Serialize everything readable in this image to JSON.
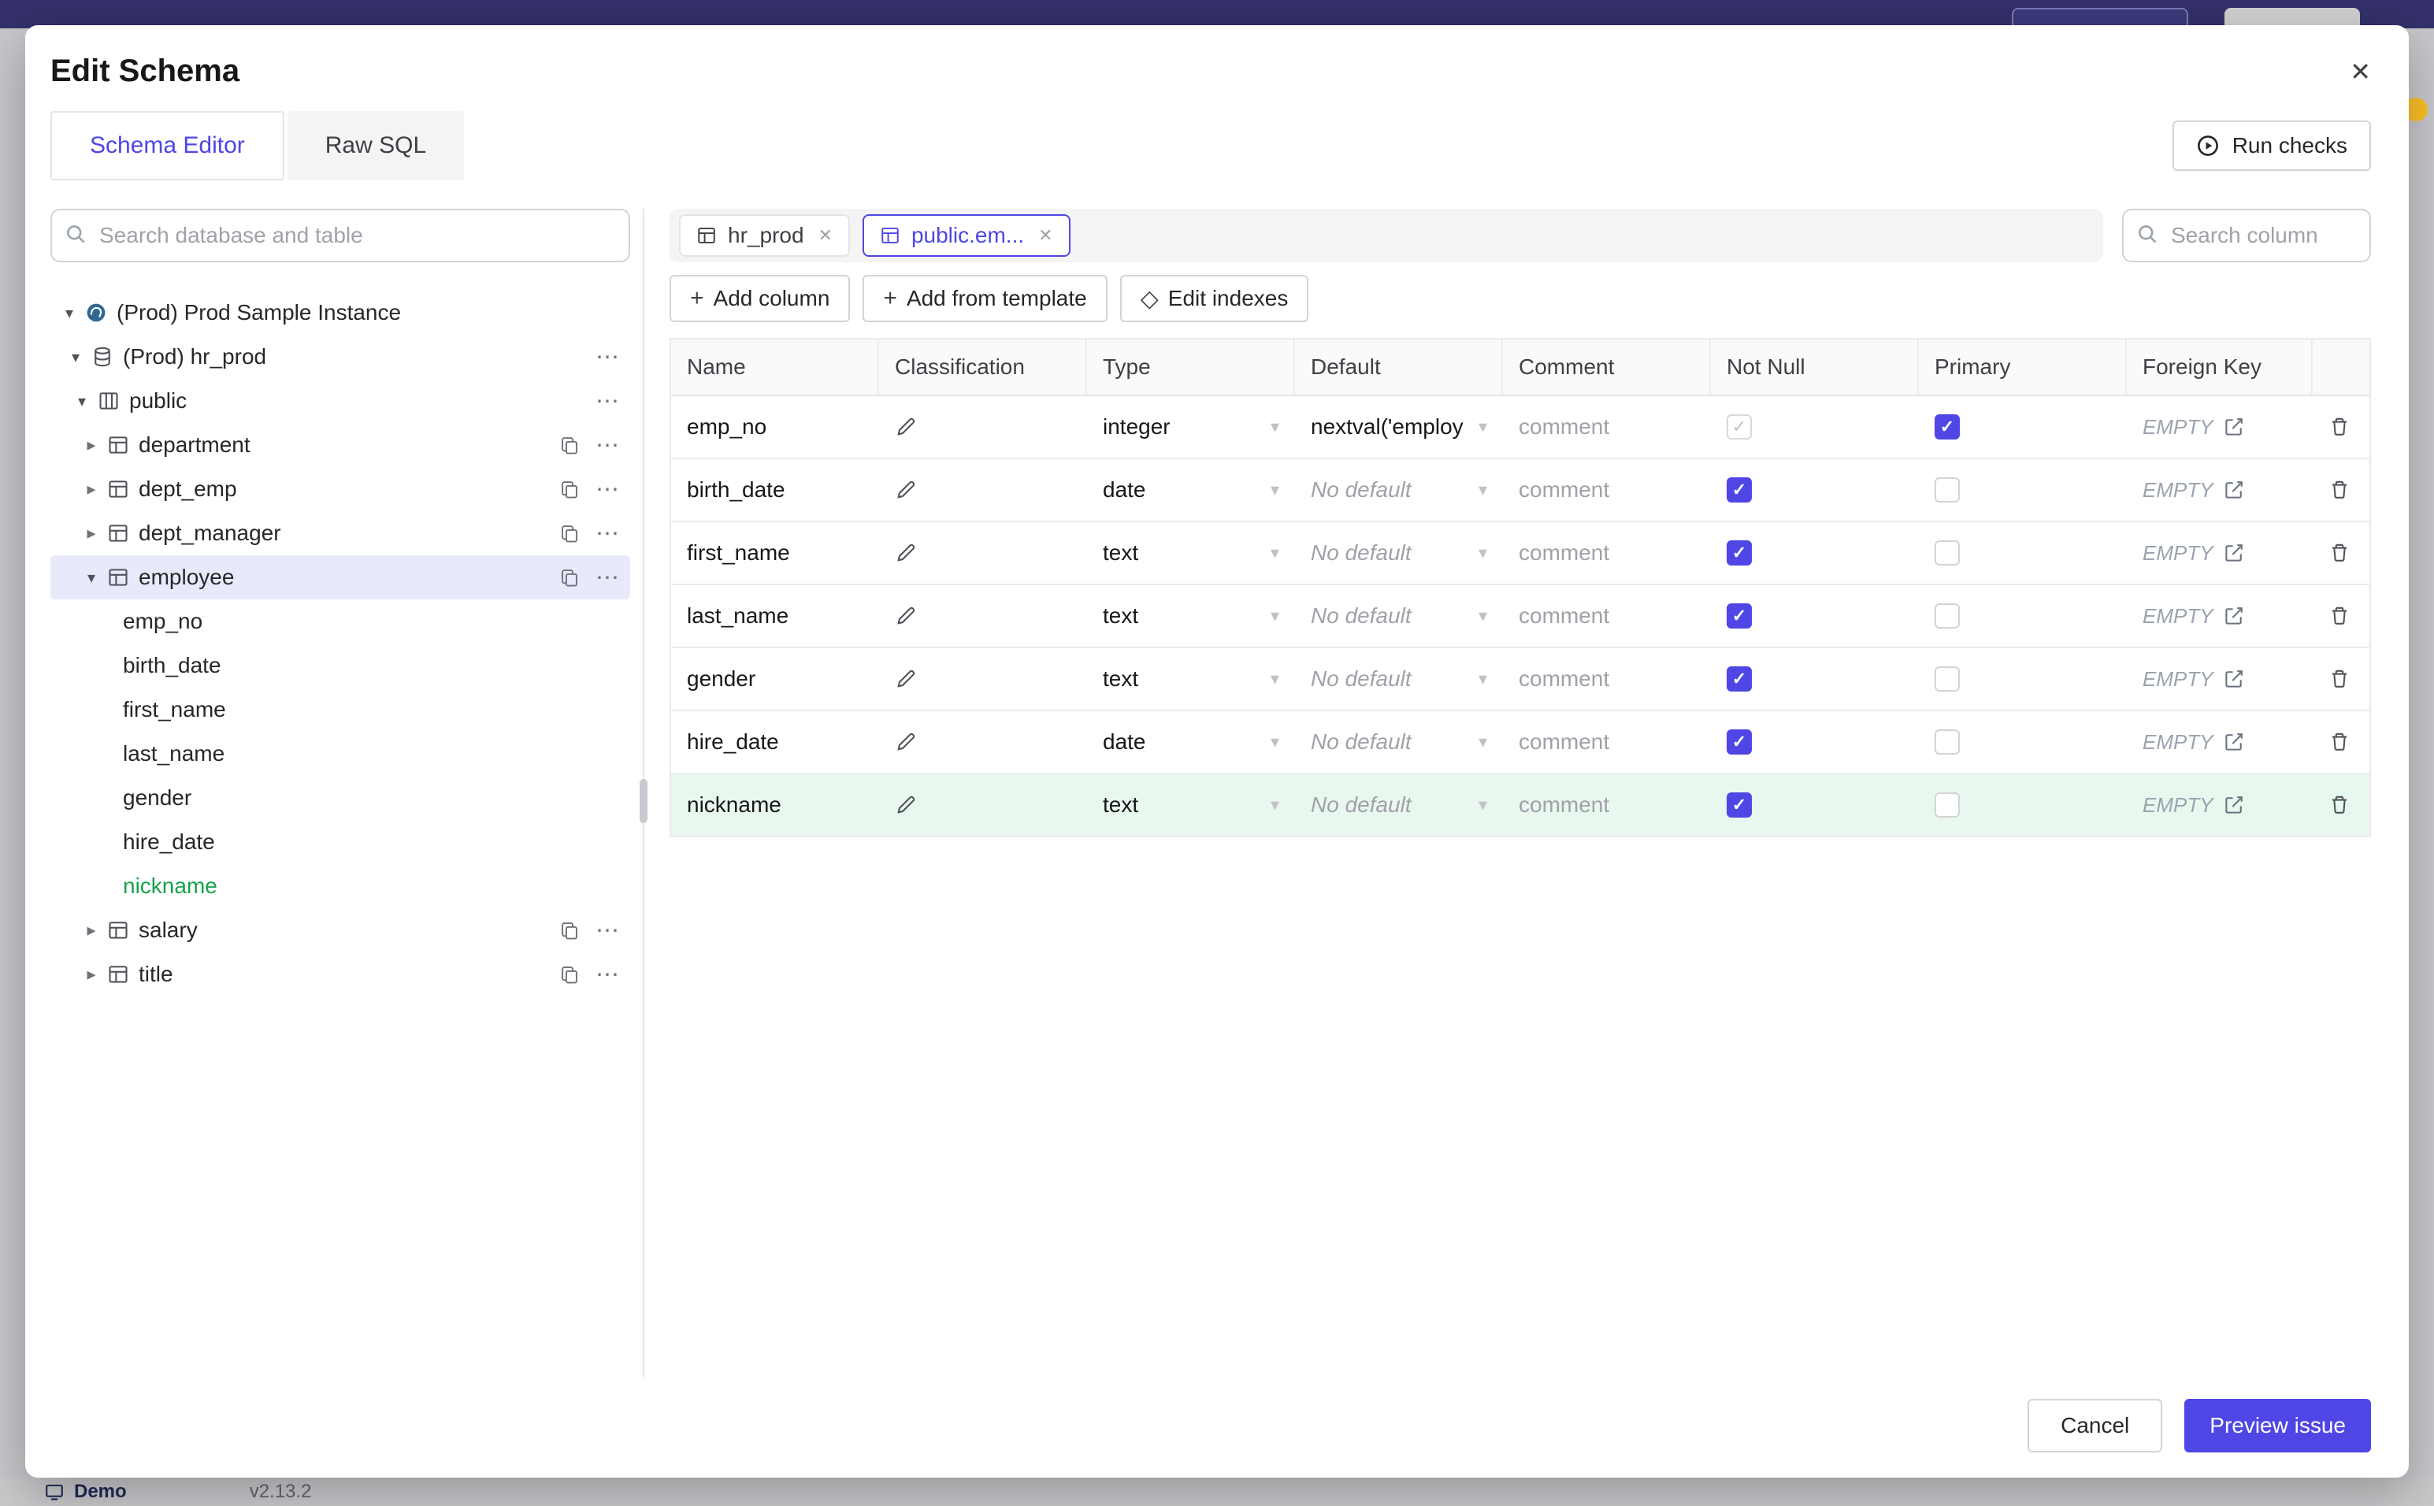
{
  "colors": {
    "primary": "#4f46e5",
    "green": "#16a34a",
    "topbar": "#363379"
  },
  "backdrop": {
    "demo_label": "Demo",
    "version": "v2.13.2"
  },
  "modal": {
    "title": "Edit Schema",
    "tabs": {
      "schema_editor": "Schema Editor",
      "raw_sql": "Raw SQL"
    },
    "run_checks_label": "Run checks",
    "cancel_label": "Cancel",
    "primary_label": "Preview issue"
  },
  "sidebar": {
    "search_placeholder": "Search database and table",
    "items": [
      {
        "label": "(Prod) Prod Sample Instance"
      },
      {
        "label": "(Prod) hr_prod"
      },
      {
        "label": "public"
      },
      {
        "label": "department"
      },
      {
        "label": "dept_emp"
      },
      {
        "label": "dept_manager"
      },
      {
        "label": "employee"
      },
      {
        "label": "emp_no"
      },
      {
        "label": "birth_date"
      },
      {
        "label": "first_name"
      },
      {
        "label": "last_name"
      },
      {
        "label": "gender"
      },
      {
        "label": "hire_date"
      },
      {
        "label": "nickname"
      },
      {
        "label": "salary"
      },
      {
        "label": "title"
      }
    ]
  },
  "editor": {
    "tabs": [
      {
        "label": "hr_prod"
      },
      {
        "label": "public.em..."
      }
    ],
    "search_placeholder": "Search column",
    "toolbar": {
      "add_column": "Add column",
      "add_from_template": "Add from template",
      "edit_indexes": "Edit indexes"
    },
    "table": {
      "headers": [
        "Name",
        "Classification",
        "Type",
        "Default",
        "Comment",
        "Not Null",
        "Primary",
        "Foreign Key"
      ],
      "comment_placeholder": "comment",
      "fk_label": "EMPTY",
      "rows": [
        {
          "name": "emp_no",
          "type": "integer",
          "default": "nextval('employ",
          "not_null": "disabled",
          "primary": true,
          "highlight": false
        },
        {
          "name": "birth_date",
          "type": "date",
          "default": "No default",
          "not_null": true,
          "primary": false,
          "highlight": false
        },
        {
          "name": "first_name",
          "type": "text",
          "default": "No default",
          "not_null": true,
          "primary": false,
          "highlight": false
        },
        {
          "name": "last_name",
          "type": "text",
          "default": "No default",
          "not_null": true,
          "primary": false,
          "highlight": false
        },
        {
          "name": "gender",
          "type": "text",
          "default": "No default",
          "not_null": true,
          "primary": false,
          "highlight": false
        },
        {
          "name": "hire_date",
          "type": "date",
          "default": "No default",
          "not_null": true,
          "primary": false,
          "highlight": false
        },
        {
          "name": "nickname",
          "type": "text",
          "default": "No default",
          "not_null": true,
          "primary": false,
          "highlight": true
        }
      ]
    }
  }
}
